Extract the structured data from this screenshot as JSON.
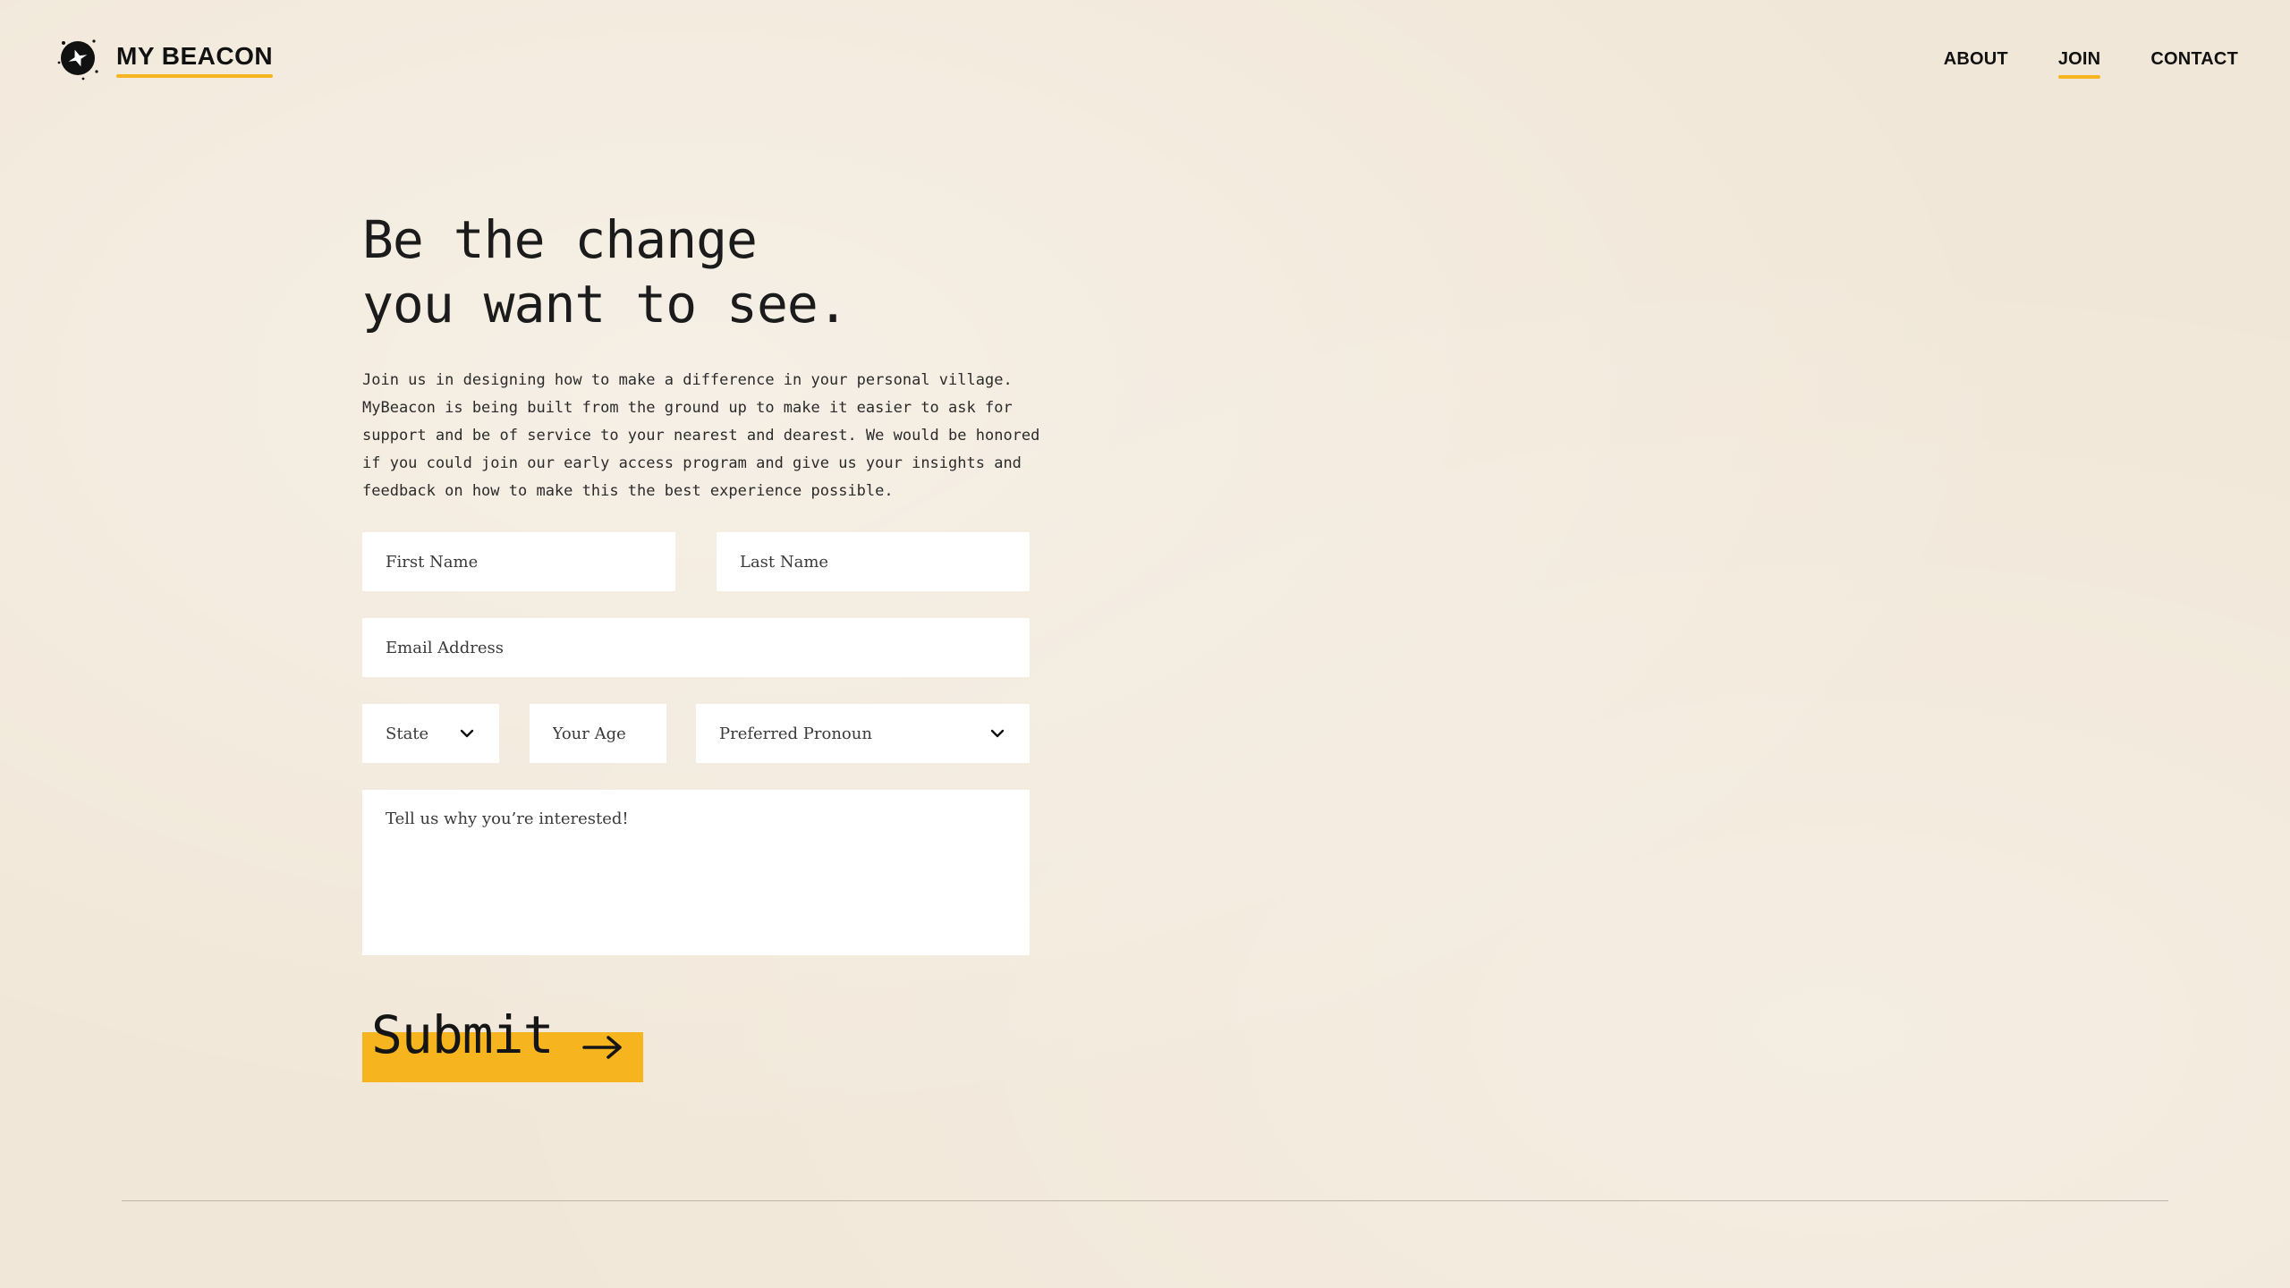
{
  "brand": {
    "name": "MY BEACON",
    "icon": "star-beacon-icon",
    "accent_color": "#f6b51f"
  },
  "nav": {
    "items": [
      {
        "label": "ABOUT",
        "active": false
      },
      {
        "label": "JOIN",
        "active": true
      },
      {
        "label": "CONTACT",
        "active": false
      }
    ]
  },
  "hero": {
    "headline_line1": "Be the change",
    "headline_line2": "you want to see.",
    "intro": "Join us in designing how to make a difference in your personal village. MyBeacon is being built from the ground up to make it easier to ask for support and be of service to your nearest and dearest. We would be honored if you could join our early access program and give us your insights and feedback on how to make this the best experience possible."
  },
  "form": {
    "first_name_placeholder": "First Name",
    "last_name_placeholder": "Last Name",
    "email_placeholder": "Email Address",
    "state_label": "State",
    "age_placeholder": "Your Age",
    "pronoun_label": "Preferred Pronoun",
    "interest_placeholder": "Tell us why you’re interested!",
    "submit_label": "Submit"
  }
}
